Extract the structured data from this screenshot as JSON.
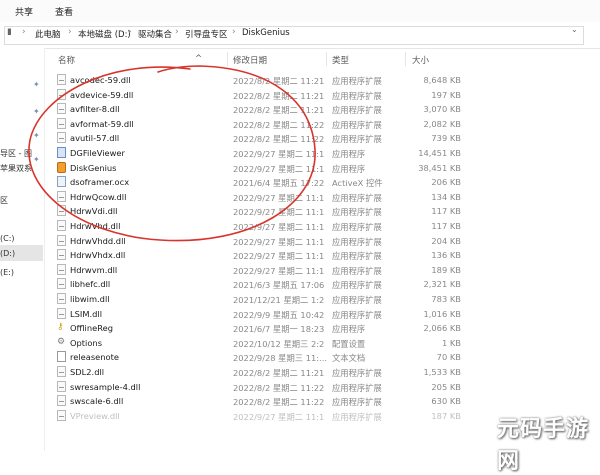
{
  "ribbon": {
    "share": "共享",
    "view": "查看"
  },
  "address": {
    "segments": [
      "此电脑",
      "本地磁盘 (D:)",
      "驱动集合",
      "引导盘专区",
      "DiskGenius"
    ]
  },
  "sidebar": {
    "items": [
      "导区 - 图",
      "苹果双系",
      "区",
      "(C:)",
      "(D:)",
      "(E:)"
    ]
  },
  "columns": {
    "name": "名称",
    "date": "修改日期",
    "type": "类型",
    "size": "大小"
  },
  "files": [
    {
      "name": "avcodec-59.dll",
      "date": "2022/8/2 星期二 11:21",
      "type": "应用程序扩展",
      "size": "8,648 KB",
      "icon": "dll"
    },
    {
      "name": "avdevice-59.dll",
      "date": "2022/8/2 星期二 11:21",
      "type": "应用程序扩展",
      "size": "197 KB",
      "icon": "dll"
    },
    {
      "name": "avfilter-8.dll",
      "date": "2022/8/2 星期二 11:21",
      "type": "应用程序扩展",
      "size": "3,070 KB",
      "icon": "dll"
    },
    {
      "name": "avformat-59.dll",
      "date": "2022/8/2 星期二 11:22",
      "type": "应用程序扩展",
      "size": "2,082 KB",
      "icon": "dll"
    },
    {
      "name": "avutil-57.dll",
      "date": "2022/8/2 星期二 11:22",
      "type": "应用程序扩展",
      "size": "739 KB",
      "icon": "dll"
    },
    {
      "name": "DGFileViewer",
      "date": "2022/9/27 星期二 11:1",
      "type": "应用程序",
      "size": "14,451 KB",
      "icon": "app"
    },
    {
      "name": "DiskGenius",
      "date": "2022/9/27 星期二 11:1",
      "type": "应用程序",
      "size": "38,451 KB",
      "icon": "genius"
    },
    {
      "name": "dsoframer.ocx",
      "date": "2021/6/4 星期五 17:22",
      "type": "ActiveX 控件",
      "size": "206 KB",
      "icon": "ocx"
    },
    {
      "name": "HdrwQcow.dll",
      "date": "2022/9/27 星期二 11:1",
      "type": "应用程序扩展",
      "size": "134 KB",
      "icon": "dll"
    },
    {
      "name": "HdrwVdi.dll",
      "date": "2022/9/27 星期二 11:1",
      "type": "应用程序扩展",
      "size": "117 KB",
      "icon": "dll"
    },
    {
      "name": "HdrwVhd.dll",
      "date": "2022/9/27 星期二 11:1",
      "type": "应用程序扩展",
      "size": "117 KB",
      "icon": "dll"
    },
    {
      "name": "HdrwVhdd.dll",
      "date": "2022/9/27 星期二 11:1",
      "type": "应用程序扩展",
      "size": "204 KB",
      "icon": "dll"
    },
    {
      "name": "HdrwVhdx.dll",
      "date": "2022/9/27 星期二 11:1",
      "type": "应用程序扩展",
      "size": "136 KB",
      "icon": "dll"
    },
    {
      "name": "Hdrwvm.dll",
      "date": "2022/9/27 星期二 11:1",
      "type": "应用程序扩展",
      "size": "189 KB",
      "icon": "dll"
    },
    {
      "name": "libhefc.dll",
      "date": "2021/6/3 星期五 17:06",
      "type": "应用程序扩展",
      "size": "2,321 KB",
      "icon": "dll"
    },
    {
      "name": "libwim.dll",
      "date": "2021/12/21 星期二 1:2",
      "type": "应用程序扩展",
      "size": "783 KB",
      "icon": "dll"
    },
    {
      "name": "LSIM.dll",
      "date": "2022/9/9 星期五 10:42",
      "type": "应用程序扩展",
      "size": "1,016 KB",
      "icon": "dll"
    },
    {
      "name": "OfflineReg",
      "date": "2021/6/7 星期一 18:23",
      "type": "应用程序",
      "size": "2,066 KB",
      "icon": "key"
    },
    {
      "name": "Options",
      "date": "2022/10/12 星期三 2:2",
      "type": "配置设置",
      "size": "1 KB",
      "icon": "cfg"
    },
    {
      "name": "releasenote",
      "date": "2022/9/28 星期三 11:...",
      "type": "文本文档",
      "size": "70 KB",
      "icon": "txt"
    },
    {
      "name": "SDL2.dll",
      "date": "2022/8/2 星期二 11:21",
      "type": "应用程序扩展",
      "size": "1,533 KB",
      "icon": "dll"
    },
    {
      "name": "swresample-4.dll",
      "date": "2022/8/2 星期二 11:22",
      "type": "应用程序扩展",
      "size": "205 KB",
      "icon": "dll"
    },
    {
      "name": "swscale-6.dll",
      "date": "2022/8/2 星期二 11:22",
      "type": "应用程序扩展",
      "size": "630 KB",
      "icon": "dll"
    },
    {
      "name": "VPreview.dll",
      "date": "2022/9/27 星期二 11:1",
      "type": "应用程序扩展",
      "size": "187 KB",
      "icon": "dll",
      "faded": true
    }
  ],
  "watermark": "元码手游网",
  "colors": {
    "annotation": "#d9342b",
    "header_text": "#5a5a5a",
    "meta_text": "#888888"
  }
}
